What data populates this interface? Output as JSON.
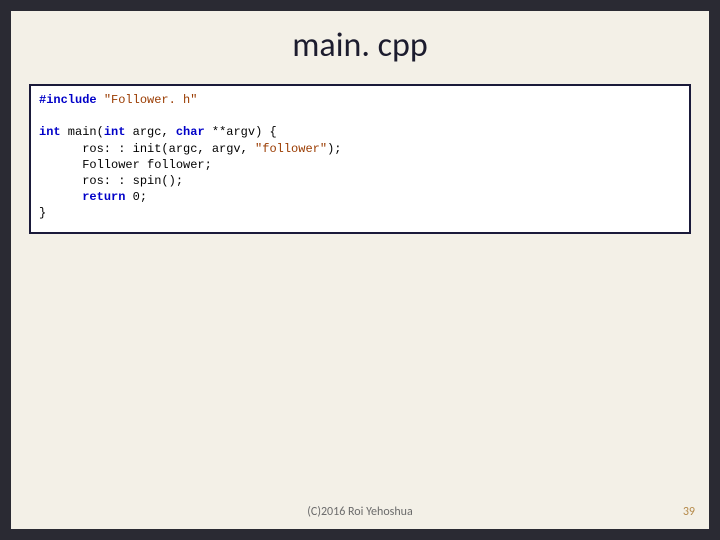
{
  "title": "main. cpp",
  "code": {
    "include_kw": "#include",
    "include_hdr": "\"Follower. h\"",
    "int1": "int",
    "main_sig1": " main(",
    "int2": "int",
    "main_sig2": " argc, ",
    "char": "char",
    "main_sig3": " **argv) {",
    "l1": "      ros: : init(argc, argv, ",
    "l1_str": "\"follower\"",
    "l1_end": ");",
    "l2": "      Follower follower;",
    "l3": "      ros: : spin();",
    "ret_indent": "      ",
    "return_kw": "return",
    "ret_tail": " 0;",
    "close": "}"
  },
  "footer": {
    "copyright": "(C)2016 Roi Yehoshua",
    "page": "39"
  }
}
